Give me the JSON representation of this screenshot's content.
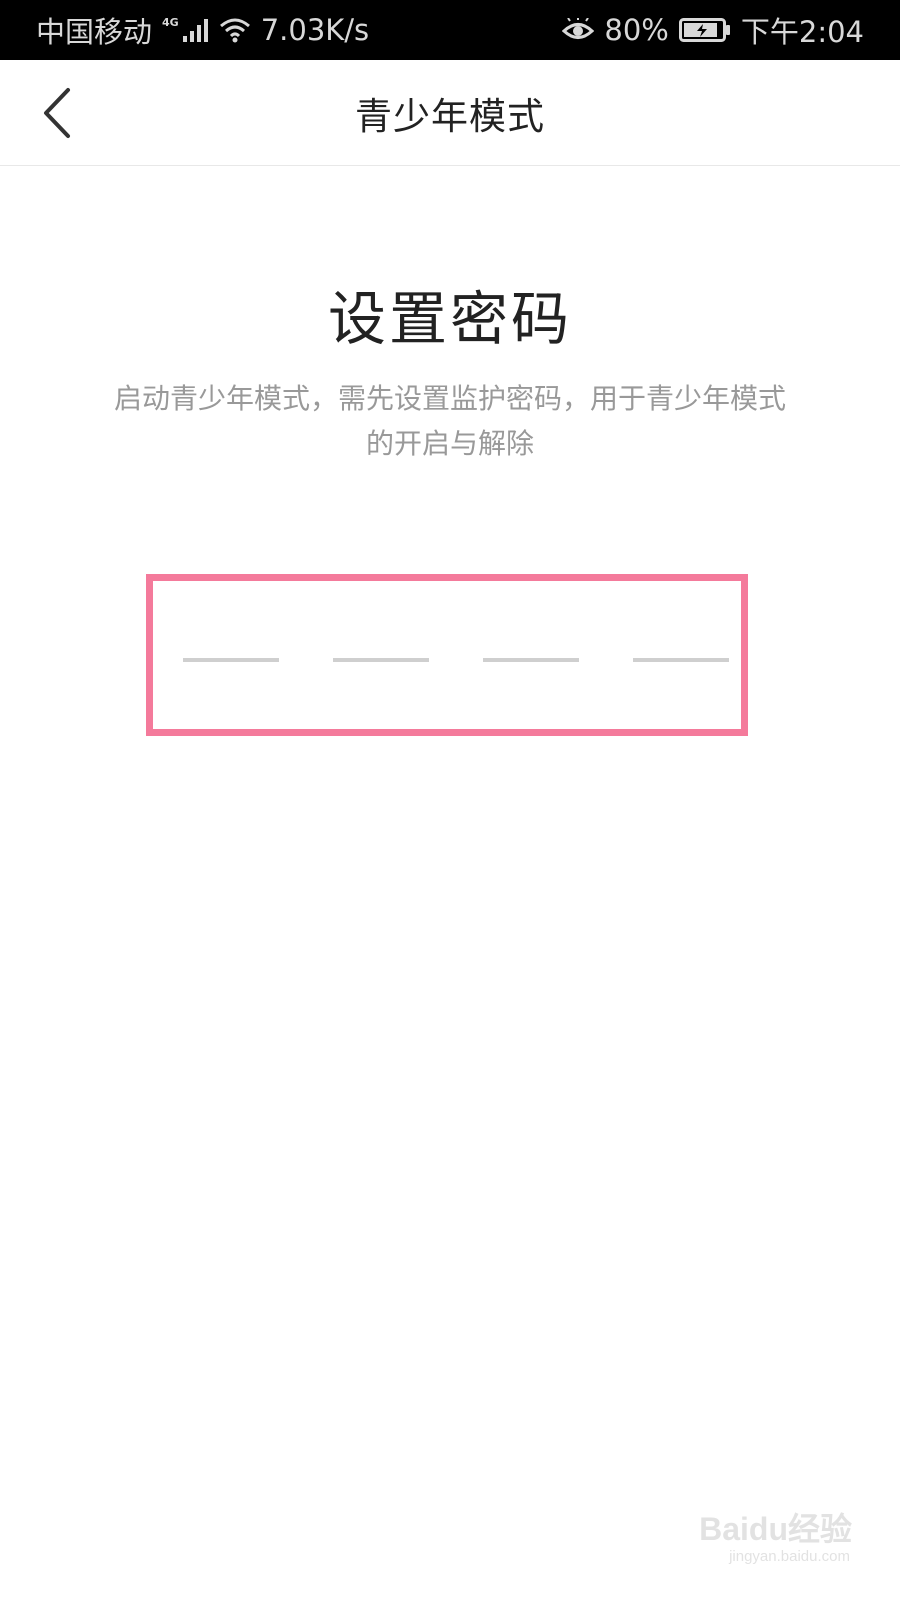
{
  "status_bar": {
    "carrier": "中国移动",
    "network_type": "4G",
    "speed": "7.03K/s",
    "battery": "80%",
    "time": "下午2:04"
  },
  "nav": {
    "title": "青少年模式",
    "back_icon": "chevron-left-icon"
  },
  "main": {
    "title": "设置密码",
    "description": "启动青少年模式，需先设置监护密码，用于青少年模式的开启与解除",
    "password_slots": 4
  },
  "watermark": {
    "brand": "Baidu经验",
    "url": "jingyan.baidu.com"
  },
  "colors": {
    "status_bar_bg": "#000000",
    "highlight_border": "#f47a9b",
    "description_text": "#999999",
    "slot_line": "#cfcfcf"
  }
}
